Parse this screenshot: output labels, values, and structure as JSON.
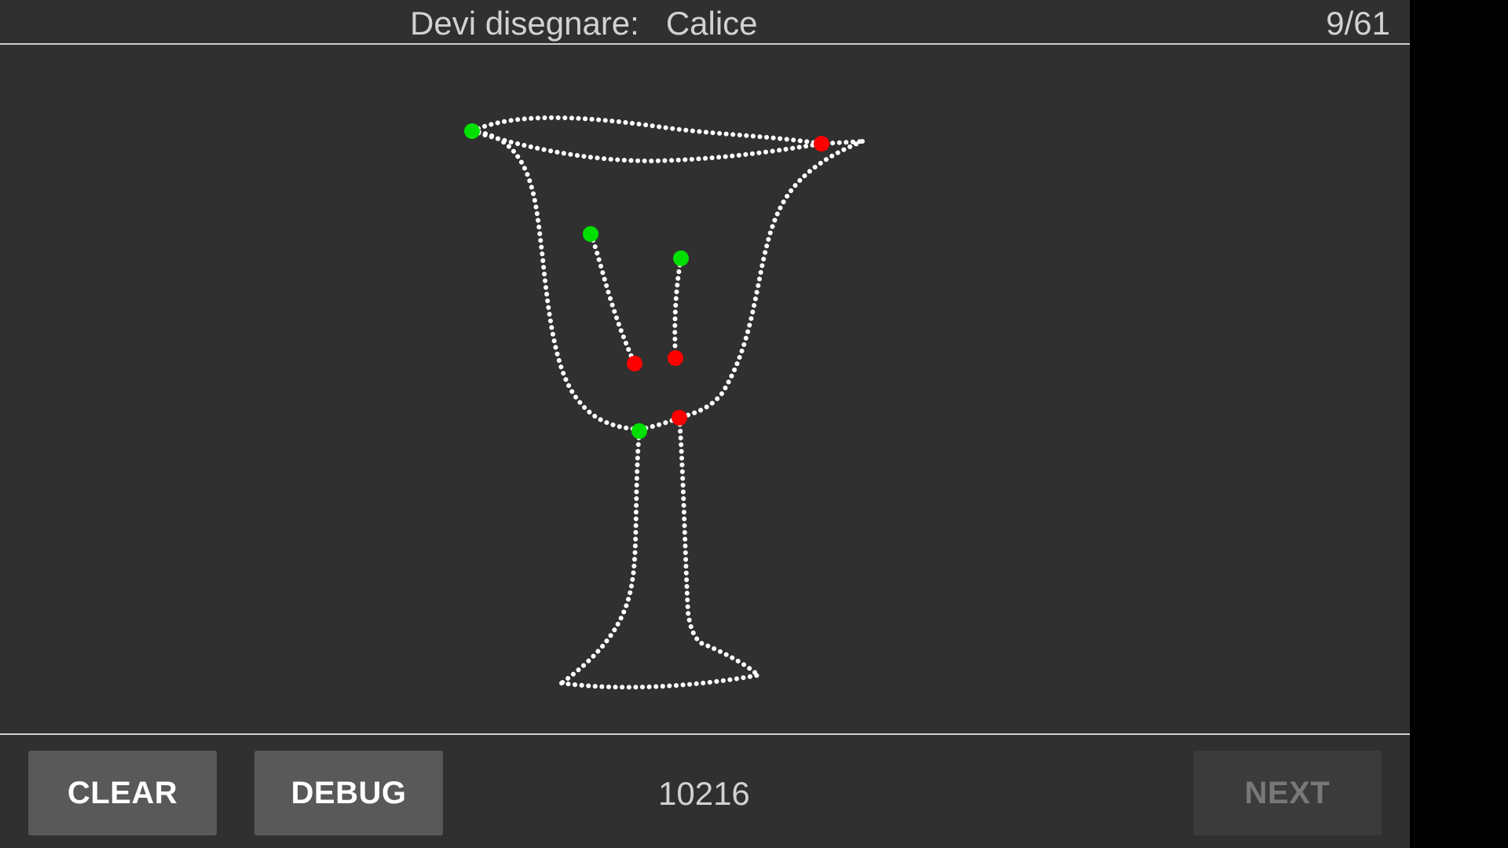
{
  "header": {
    "prompt_label": "Devi disegnare:",
    "target_word": "Calice",
    "progress": "9/61"
  },
  "footer": {
    "clear_label": "CLEAR",
    "debug_label": "DEBUG",
    "score": "10216",
    "next_label": "NEXT",
    "next_enabled": false
  },
  "colors": {
    "background": "#303030",
    "stroke": "#ffffff",
    "stroke_start": "#00e000",
    "stroke_end": "#ff0000"
  }
}
